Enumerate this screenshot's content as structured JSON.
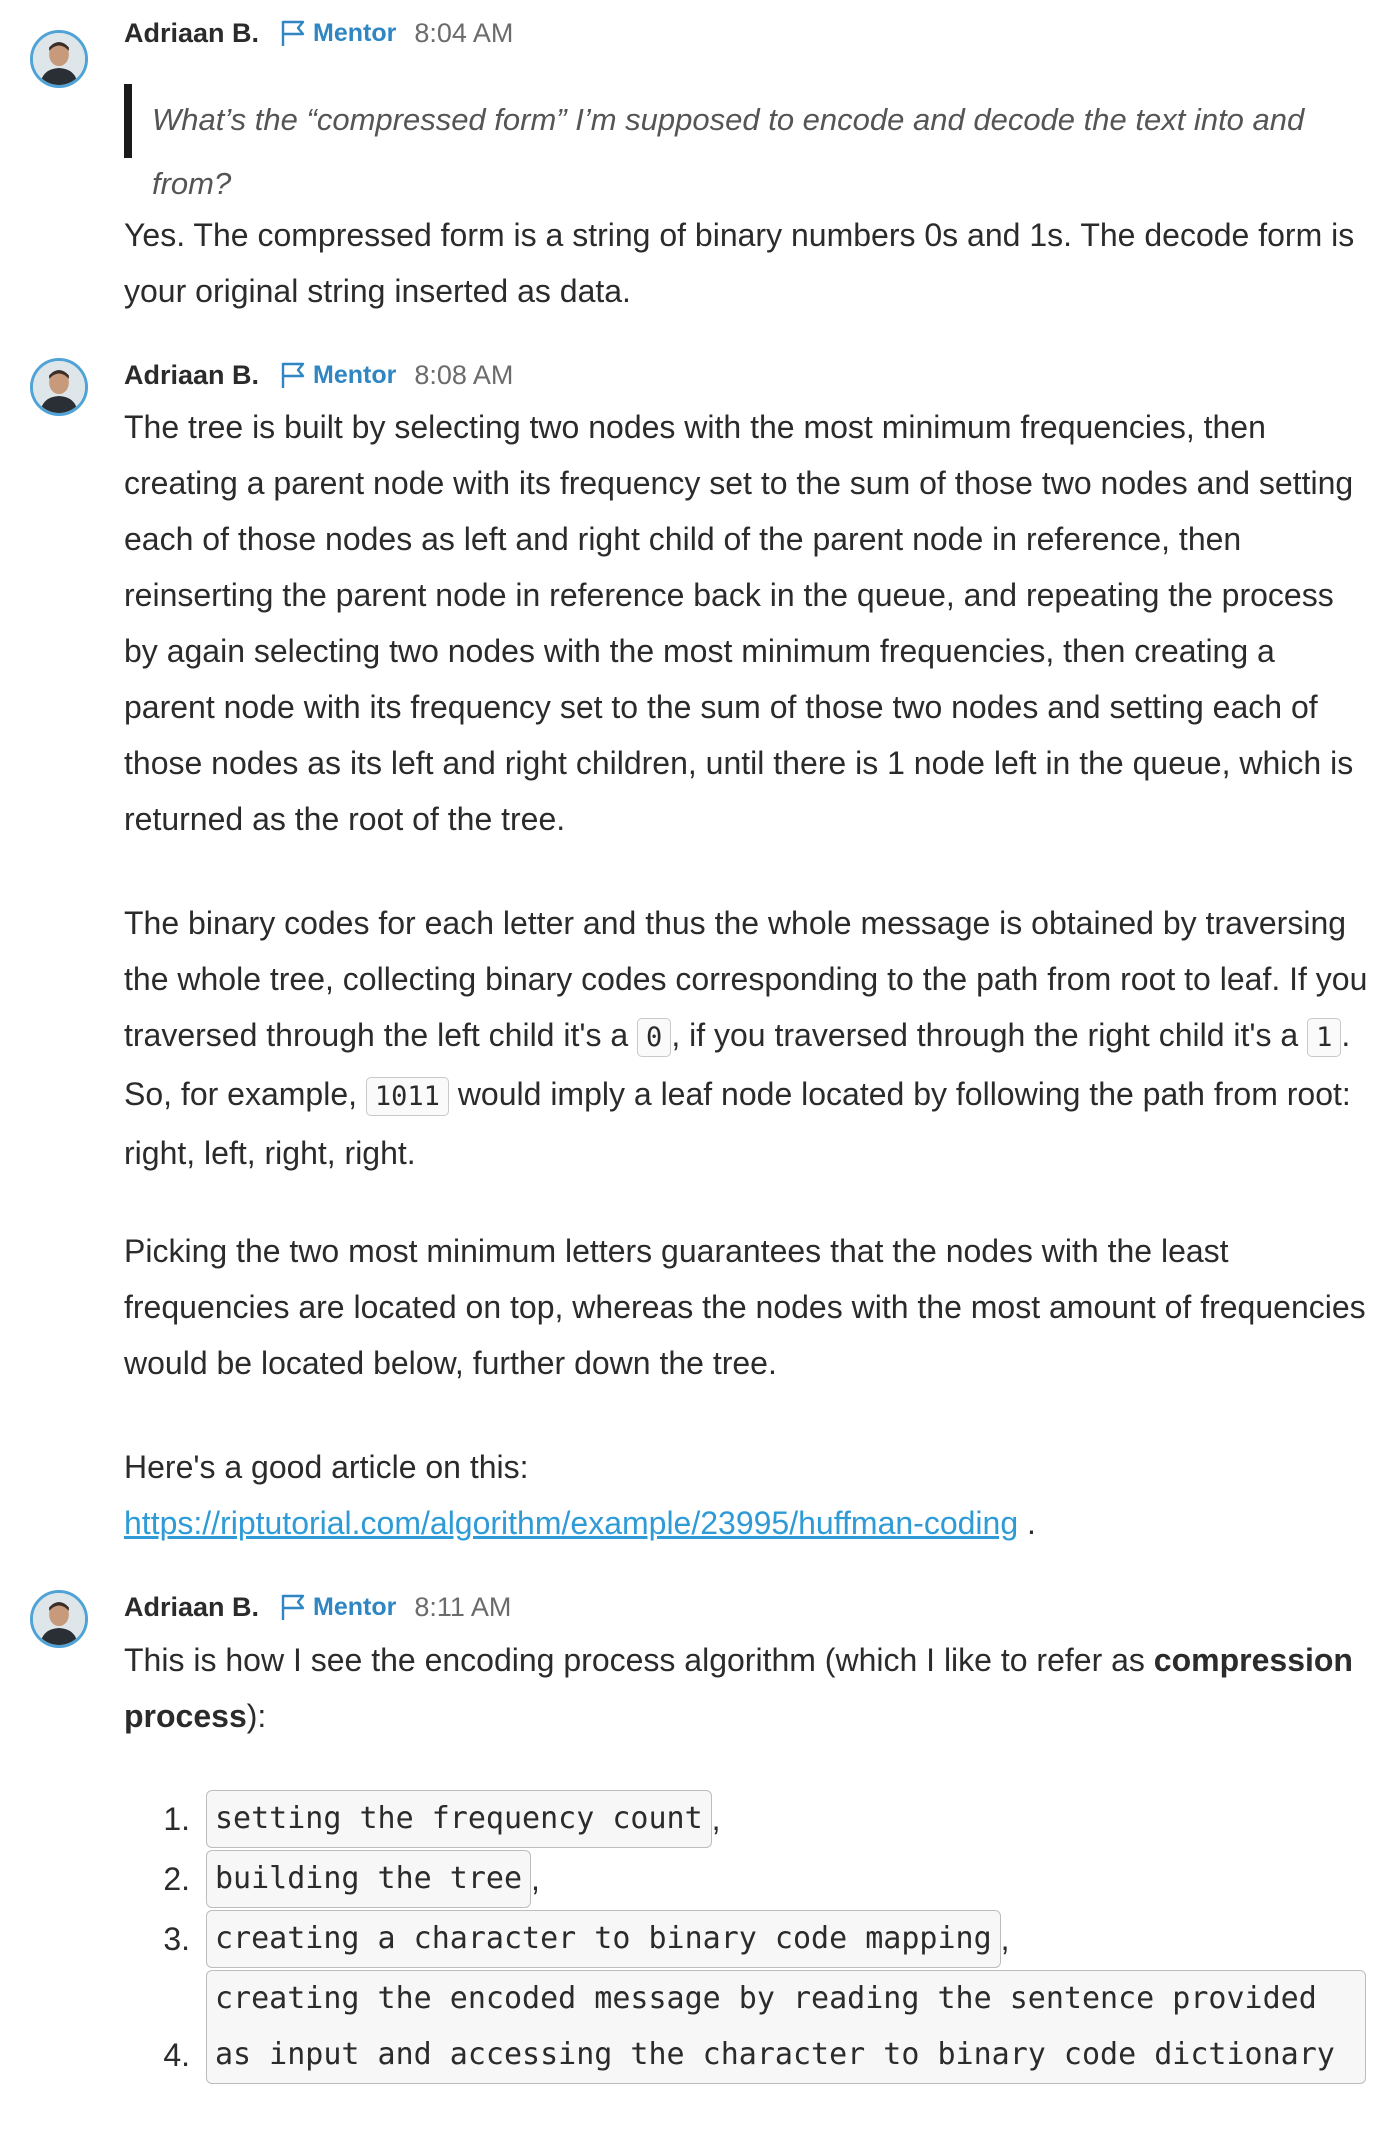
{
  "messages": [
    {
      "author": "Adriaan B.",
      "role": "Mentor",
      "time": "8:04 AM",
      "quote": "What’s the “compressed form” I’m supposed to encode and decode the text into and from?",
      "body": "Yes. The compressed form is a string of binary numbers 0s and 1s. The decode form is your original string inserted as data."
    },
    {
      "author": "Adriaan B.",
      "role": "Mentor",
      "time": "8:08 AM",
      "p1": "The tree is built by selecting two nodes with the most minimum frequencies, then creating a parent node with its frequency set to the sum of those two nodes and setting each of those nodes as left and right child of the parent node in reference, then reinserting the parent node in reference back in the queue, and repeating the process by again selecting two nodes with the most minimum frequencies, then creating a parent node with its frequency set to the sum of those two nodes and setting each of those nodes as its left and right children, until there is 1 node left in the queue, which is returned as the root of the tree.",
      "p2_a": "The binary codes for each letter and thus the whole message is obtained by traversing the whole tree, collecting binary codes corresponding to the path from root to leaf. If you traversed through the left child it's a ",
      "p2_code1": "0",
      "p2_b": ", if you traversed through the right child it's a ",
      "p2_code2": "1",
      "p2_c": ". So, for example, ",
      "p2_code3": "1011",
      "p2_d": " would imply a leaf node located by following the path from root: right, left, right, right.",
      "p3": "Picking the two most minimum letters guarantees that the nodes with the least frequencies are located on top, whereas the nodes with the most amount of frequencies would be located below, further down the tree.",
      "p4_text": "Here's a good article on this:",
      "p4_link": "https://riptutorial.com/algorithm/example/23995/huffman-coding",
      "p4_end": " ."
    },
    {
      "author": "Adriaan B.",
      "role": "Mentor",
      "time": "8:11 AM",
      "intro_a": "This is how I see the encoding process algorithm (which I like to refer as ",
      "intro_bold": "compression process",
      "intro_b": "):",
      "steps": [
        {
          "num": "1.",
          "code": "setting the frequency count",
          "suffix": ","
        },
        {
          "num": "2.",
          "code": "building the tree",
          "suffix": ","
        },
        {
          "num": "3.",
          "code": "creating a character to binary code mapping",
          "suffix": ","
        },
        {
          "num": "4.",
          "code": "creating the encoded message by reading the sentence provided as input and accessing the character to binary code dictionary",
          "suffix": ""
        }
      ]
    }
  ],
  "icons": {
    "avatar": "user-avatar-photo",
    "role_badge": "flag-icon"
  },
  "colors": {
    "link": "#2f9bd6",
    "mentor": "#2f86c2",
    "avatar_ring": "#4fa3d6"
  }
}
